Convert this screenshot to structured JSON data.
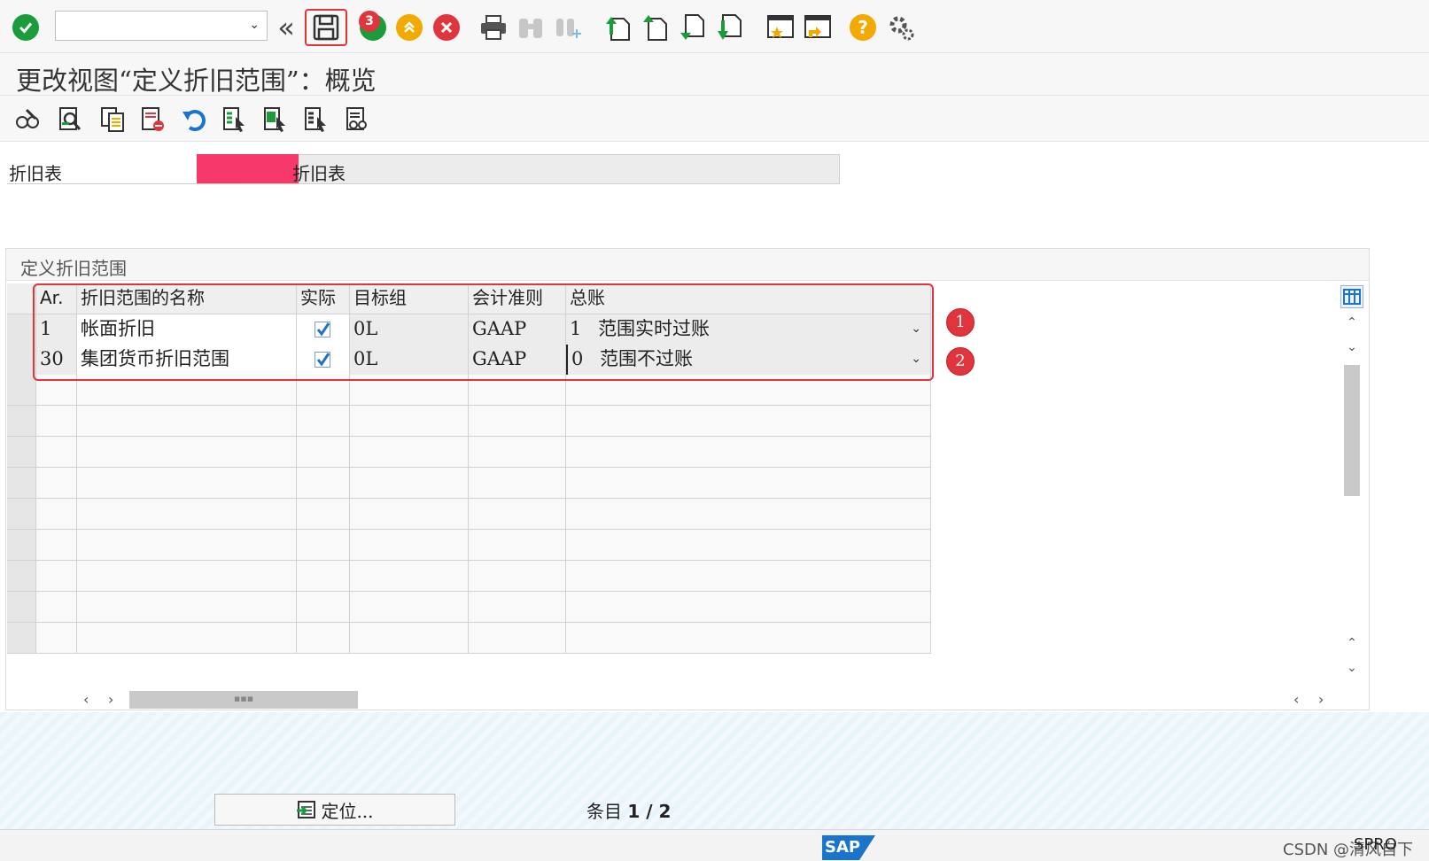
{
  "toolbar": {
    "command_field_value": "",
    "command_badge": "3",
    "colors": {
      "accent_red": "#e0353d",
      "ok_green": "#1a9c3a",
      "warn_orange": "#f2a900"
    }
  },
  "title": "更改视图“定义折旧范围”：概览",
  "header_field": {
    "label": "折旧表",
    "value": "折旧表"
  },
  "table": {
    "caption": "定义折旧范围",
    "columns": [
      "Ar.",
      "折旧范围的名称",
      "实际",
      "目标组",
      "会计准则",
      "总账"
    ],
    "rows": [
      {
        "area": "1",
        "name": "帐面折旧",
        "real": true,
        "target_group": "0L",
        "accounting_principle": "GAAP",
        "gl_code": "1",
        "gl_text": "范围实时过账"
      },
      {
        "area": "30",
        "name": "集团货币折旧范围",
        "real": true,
        "target_group": "0L",
        "accounting_principle": "GAAP",
        "gl_code": "0",
        "gl_text": "范围不过账"
      }
    ]
  },
  "markers": [
    "1",
    "2"
  ],
  "footer": {
    "position_button": "定位...",
    "entry_label": "条目",
    "entry_value": "1 / 2"
  },
  "statusbar": {
    "logo": "SAP",
    "watermark": "CSDN @清风自下",
    "transaction": "SPRO"
  }
}
